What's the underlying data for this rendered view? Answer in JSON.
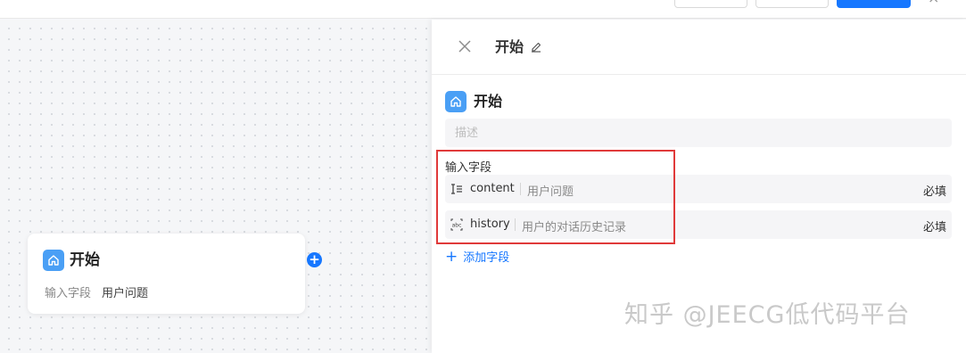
{
  "top_bar": {
    "close_glyph": "×"
  },
  "canvas": {
    "node": {
      "title": "开始",
      "icon": "home-icon",
      "field_label": "输入字段",
      "field_value": "用户问题"
    },
    "add_glyph": "+"
  },
  "panel": {
    "title": "开始",
    "section_title": "开始",
    "description_placeholder": "描述",
    "input_fields_label": "输入字段",
    "fields": [
      {
        "type_icon": "text-type-icon",
        "name": "content",
        "description": "用户问题",
        "required": "必填"
      },
      {
        "type_icon": "abc-type-icon",
        "name": "history",
        "description": "用户的对话历史记录",
        "required": "必填"
      }
    ],
    "add_field_plus": "+",
    "add_field_label": "添加字段"
  },
  "watermark": "知乎 @JEECG低代码平台",
  "colors": {
    "accent": "#1677ff",
    "node_icon_bg": "#4a9ff5",
    "highlight": "#e03a3a"
  }
}
